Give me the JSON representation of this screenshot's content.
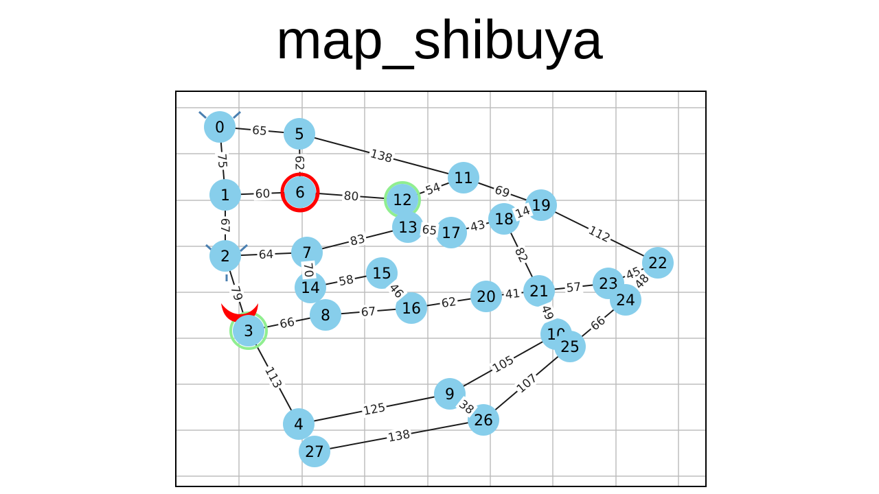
{
  "title": "map_shibuya",
  "colors": {
    "node_fill": "#87ceeb",
    "edge": "#1a1a1a",
    "grid": "#bdbdbd",
    "frame": "#000000",
    "highlight_red": "#ff0000",
    "highlight_green": "#90ee90",
    "marker_blue": "#4a7fb0"
  },
  "nodes": [
    "0",
    "1",
    "2",
    "3",
    "4",
    "5",
    "6",
    "7",
    "8",
    "9",
    "10",
    "11",
    "12",
    "13",
    "14",
    "15",
    "16",
    "17",
    "18",
    "19",
    "20",
    "21",
    "22",
    "23",
    "24",
    "25",
    "26",
    "27"
  ],
  "edges": [
    {
      "from": "0",
      "to": "5",
      "weight": "65"
    },
    {
      "from": "0",
      "to": "1",
      "weight": "75"
    },
    {
      "from": "5",
      "to": "6",
      "weight": "62"
    },
    {
      "from": "5",
      "to": "11",
      "weight": "138"
    },
    {
      "from": "1",
      "to": "6",
      "weight": "60"
    },
    {
      "from": "1",
      "to": "2",
      "weight": "67"
    },
    {
      "from": "6",
      "to": "12",
      "weight": "80"
    },
    {
      "from": "12",
      "to": "11",
      "weight": "54"
    },
    {
      "from": "11",
      "to": "19",
      "weight": "69"
    },
    {
      "from": "19",
      "to": "22",
      "weight": "112"
    },
    {
      "from": "2",
      "to": "7",
      "weight": "64"
    },
    {
      "from": "7",
      "to": "13",
      "weight": "83"
    },
    {
      "from": "13",
      "to": "17",
      "weight": "65"
    },
    {
      "from": "17",
      "to": "18",
      "weight": "43"
    },
    {
      "from": "18",
      "to": "19",
      "weight": "14"
    },
    {
      "from": "18",
      "to": "21",
      "weight": "82"
    },
    {
      "from": "2",
      "to": "3",
      "weight": "79"
    },
    {
      "from": "7",
      "to": "14",
      "weight": "70"
    },
    {
      "from": "14",
      "to": "15",
      "weight": "58"
    },
    {
      "from": "15",
      "to": "16",
      "weight": "46"
    },
    {
      "from": "3",
      "to": "8",
      "weight": "66"
    },
    {
      "from": "8",
      "to": "16",
      "weight": "67"
    },
    {
      "from": "16",
      "to": "20",
      "weight": "62"
    },
    {
      "from": "20",
      "to": "21",
      "weight": "41"
    },
    {
      "from": "21",
      "to": "23",
      "weight": "57"
    },
    {
      "from": "23",
      "to": "22",
      "weight": "45"
    },
    {
      "from": "24",
      "to": "22",
      "weight": "48"
    },
    {
      "from": "21",
      "to": "10",
      "weight": "49"
    },
    {
      "from": "24",
      "to": "25",
      "weight": "66"
    },
    {
      "from": "3",
      "to": "4",
      "weight": "113"
    },
    {
      "from": "4",
      "to": "9",
      "weight": "125"
    },
    {
      "from": "9",
      "to": "10",
      "weight": "105"
    },
    {
      "from": "9",
      "to": "26",
      "weight": "38"
    },
    {
      "from": "26",
      "to": "25",
      "weight": "107"
    },
    {
      "from": "27",
      "to": "26",
      "weight": "138"
    }
  ]
}
